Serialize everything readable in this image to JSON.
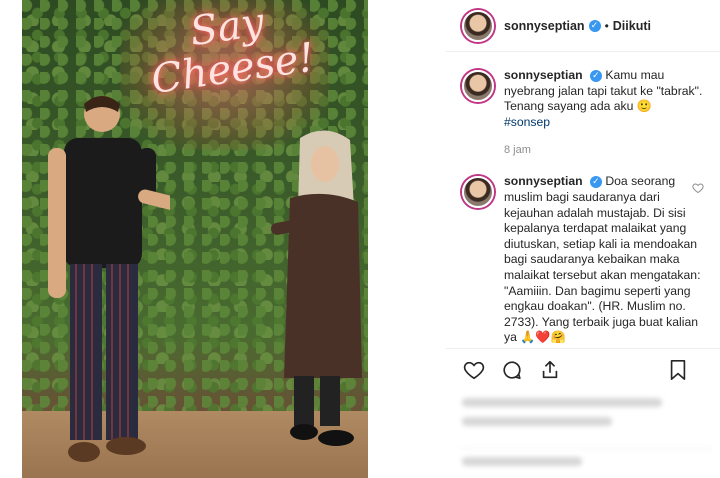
{
  "photo": {
    "neon_sign": "Say Cheese!"
  },
  "post": {
    "username": "sonnyseptian",
    "verified": true,
    "follow_state": "Diikuti",
    "separator": "•"
  },
  "comments": [
    {
      "username": "sonnyseptian",
      "text": "Kamu mau nyebrang jalan tapi takut ke \"tabrak\". Tenang sayang ada aku 🙂",
      "hashtag": "#sonsep",
      "timestamp": "8 jam"
    },
    {
      "username": "sonnyseptian",
      "text": "Doa seorang muslim bagi saudaranya dari kejauhan adalah mustajab. Di sisi kepalanya terdapat malaikat yang diutuskan, setiap kali ia mendoakan bagi saudaranya kebaikan maka malaikat tersebut akan mengatakan: \"Aamiiin. Dan bagimu seperti yang engkau doakan\". (HR. Muslim no. 2733). Yang terbaik juga buat kalian ya 🙏❤️🤗"
    }
  ],
  "actions": {
    "icons": [
      "heart-icon",
      "comment-icon",
      "share-icon",
      "bookmark-icon"
    ]
  },
  "colors": {
    "verified_badge": "#3897f0",
    "story_ring": "#c13584",
    "hashtag": "#00376b",
    "timestamp": "#8e8e8e",
    "divider": "#efefef"
  }
}
